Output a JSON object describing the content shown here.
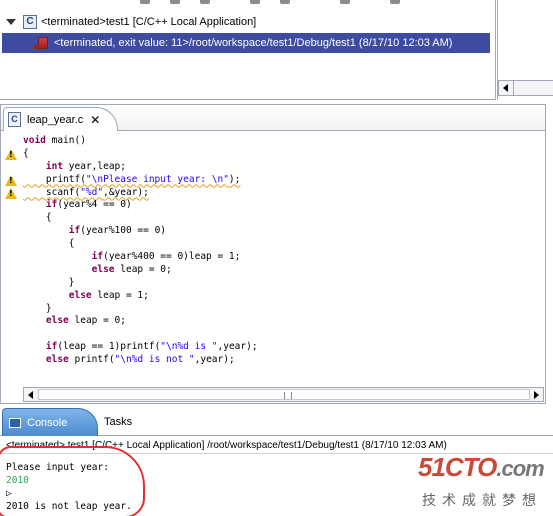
{
  "debug": {
    "launch_label": "<terminated>test1 [C/C++ Local Application]",
    "process_label": "<terminated, exit value: 11>/root/workspace/test1/Debug/test1 (8/17/10 12:03 AM)",
    "c_icon_letter": "C"
  },
  "editor": {
    "tab_label": "leap_year.c",
    "tab_close": "✕",
    "file_icon_letter": "C",
    "lines": [
      {
        "t": [
          {
            "s": "void",
            "c": "kw"
          },
          {
            "s": " main()"
          }
        ]
      },
      {
        "t": [
          {
            "s": "{"
          }
        ]
      },
      {
        "t": [
          {
            "s": "    "
          },
          {
            "s": "int",
            "c": "kw"
          },
          {
            "s": " year,leap;"
          }
        ]
      },
      {
        "t": [
          {
            "s": "    printf(",
            "c": "squiggle"
          },
          {
            "s": "\"\\nPlease input year: \\n\"",
            "c": "str squiggle"
          },
          {
            "s": ");",
            "c": "squiggle"
          }
        ]
      },
      {
        "t": [
          {
            "s": "    scanf(",
            "c": "squiggle"
          },
          {
            "s": "\"%d\"",
            "c": "str squiggle"
          },
          {
            "s": ",&year);",
            "c": "squiggle"
          }
        ]
      },
      {
        "t": [
          {
            "s": "    "
          },
          {
            "s": "if",
            "c": "kw"
          },
          {
            "s": "(year%4 == 0)"
          }
        ]
      },
      {
        "t": [
          {
            "s": "    {"
          }
        ]
      },
      {
        "t": [
          {
            "s": "        "
          },
          {
            "s": "if",
            "c": "kw"
          },
          {
            "s": "(year%100 == 0)"
          }
        ]
      },
      {
        "t": [
          {
            "s": "        {"
          }
        ]
      },
      {
        "t": [
          {
            "s": "            "
          },
          {
            "s": "if",
            "c": "kw"
          },
          {
            "s": "(year%400 == 0)leap = 1;"
          }
        ]
      },
      {
        "t": [
          {
            "s": "            "
          },
          {
            "s": "else",
            "c": "kw"
          },
          {
            "s": " leap = 0;"
          }
        ]
      },
      {
        "t": [
          {
            "s": "        }"
          }
        ]
      },
      {
        "t": [
          {
            "s": "        "
          },
          {
            "s": "else",
            "c": "kw"
          },
          {
            "s": " leap = 1;"
          }
        ]
      },
      {
        "t": [
          {
            "s": "    }"
          }
        ]
      },
      {
        "t": [
          {
            "s": "    "
          },
          {
            "s": "else",
            "c": "kw"
          },
          {
            "s": " leap = 0;"
          }
        ]
      },
      {
        "t": [
          {
            "s": ""
          }
        ]
      },
      {
        "t": [
          {
            "s": "    "
          },
          {
            "s": "if",
            "c": "kw"
          },
          {
            "s": "(leap == 1)printf("
          },
          {
            "s": "\"\\n%d is \"",
            "c": "str"
          },
          {
            "s": ",year);"
          }
        ]
      },
      {
        "t": [
          {
            "s": "    "
          },
          {
            "s": "else",
            "c": "kw"
          },
          {
            "s": " printf("
          },
          {
            "s": "\"\\n%d is not \"",
            "c": "str"
          },
          {
            "s": ",year);"
          }
        ]
      }
    ],
    "warning_lines": [
      1,
      3,
      4
    ]
  },
  "console": {
    "tab_label": "Console",
    "tasks_label": "Tasks",
    "status": "<terminated> test1 [C/C++ Local Application] /root/workspace/test1/Debug/test1 (8/17/10 12:03 AM)",
    "output": [
      {
        "text": "Please input year:",
        "kind": "normal"
      },
      {
        "text": "2010",
        "kind": "input"
      },
      {
        "text": "",
        "kind": "caret"
      },
      {
        "text": "2010 is not leap year.",
        "kind": "normal"
      }
    ]
  },
  "watermark": {
    "logo": "51CTO",
    "logo_suffix": ".com",
    "tagline": "技术成就梦想"
  },
  "colors": {
    "selection": "#3d4ca0",
    "keyword": "#7f0055",
    "string": "#2a00ff",
    "warning": "#e8b81c",
    "annotation": "#e03030",
    "console_tab": "#4b8bd0"
  }
}
